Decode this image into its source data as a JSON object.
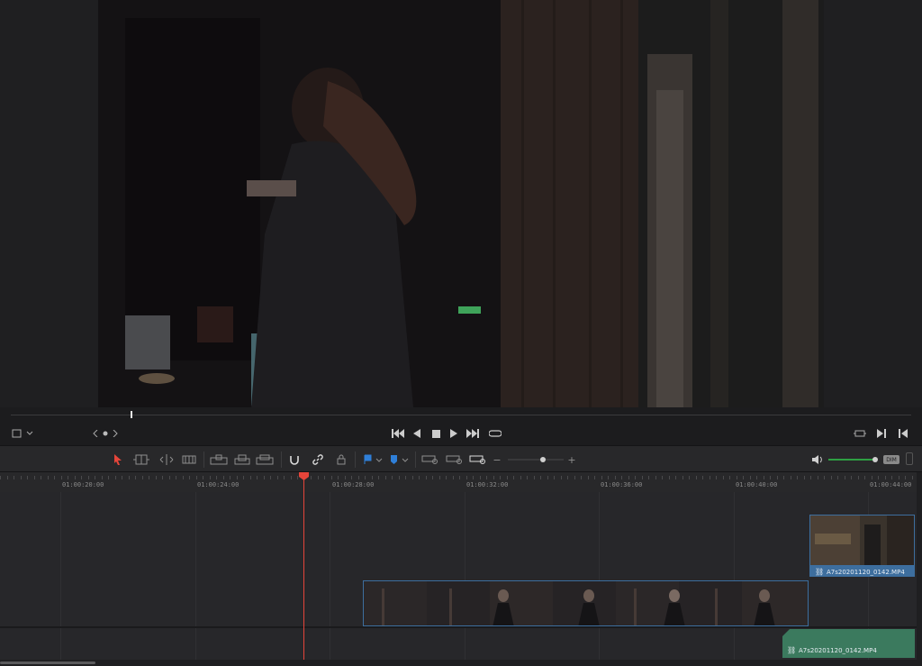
{
  "viewer": {
    "frame_description_icon": "video-frame"
  },
  "transport": {
    "viewer_mode_icon": "crop-icon",
    "nav_prev_icon": "chevron-left-icon",
    "nav_dot_icon": "dot-icon",
    "nav_next_icon": "chevron-right-icon"
  },
  "ruler": {
    "timecodes": [
      "01:00:20:00",
      "01:00:24:00",
      "01:00:28:00",
      "01:00:32:00",
      "01:00:36:00",
      "01:00:40:00",
      "01:00:44:00"
    ]
  },
  "toolbar": {
    "dim_label": "DIM",
    "zoom_plus": "+",
    "zoom_minus": "−"
  },
  "timeline": {
    "clips": [
      {
        "name": "A7s20201120_0142.MP4",
        "track": "V2"
      },
      {
        "name": "",
        "track": "V1"
      },
      {
        "name": "A7s20201120_0142.MP4",
        "track": "A1"
      }
    ]
  },
  "colors": {
    "accent_red": "#e5453a",
    "video_clip_blue": "#3d6e9e",
    "audio_clip_green": "#3b7a5e",
    "volume_green": "#2ea043"
  }
}
